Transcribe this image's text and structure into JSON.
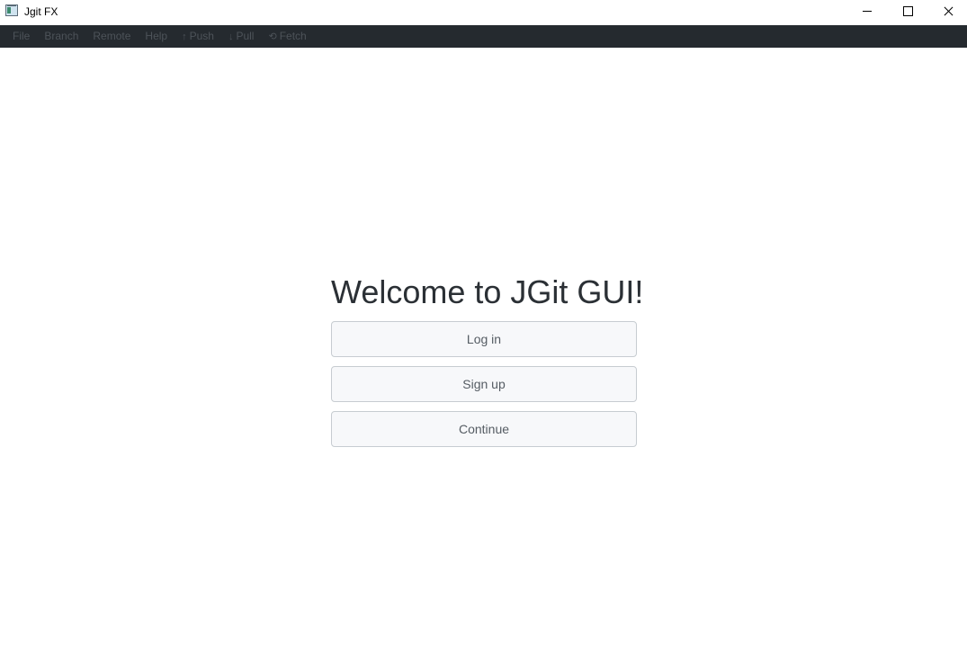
{
  "window": {
    "title": "Jgit FX",
    "icon": "app-icon"
  },
  "menubar": {
    "items": [
      {
        "label": "File"
      },
      {
        "label": "Branch"
      },
      {
        "label": "Remote"
      },
      {
        "label": "Help"
      },
      {
        "icon": "↑",
        "label": "Push"
      },
      {
        "icon": "↓",
        "label": "Pull"
      },
      {
        "icon": "⟲",
        "label": "Fetch"
      }
    ]
  },
  "main": {
    "heading": "Welcome to JGit GUI!",
    "buttons": {
      "login": "Log in",
      "signup": "Sign up",
      "continue": "Continue"
    }
  }
}
